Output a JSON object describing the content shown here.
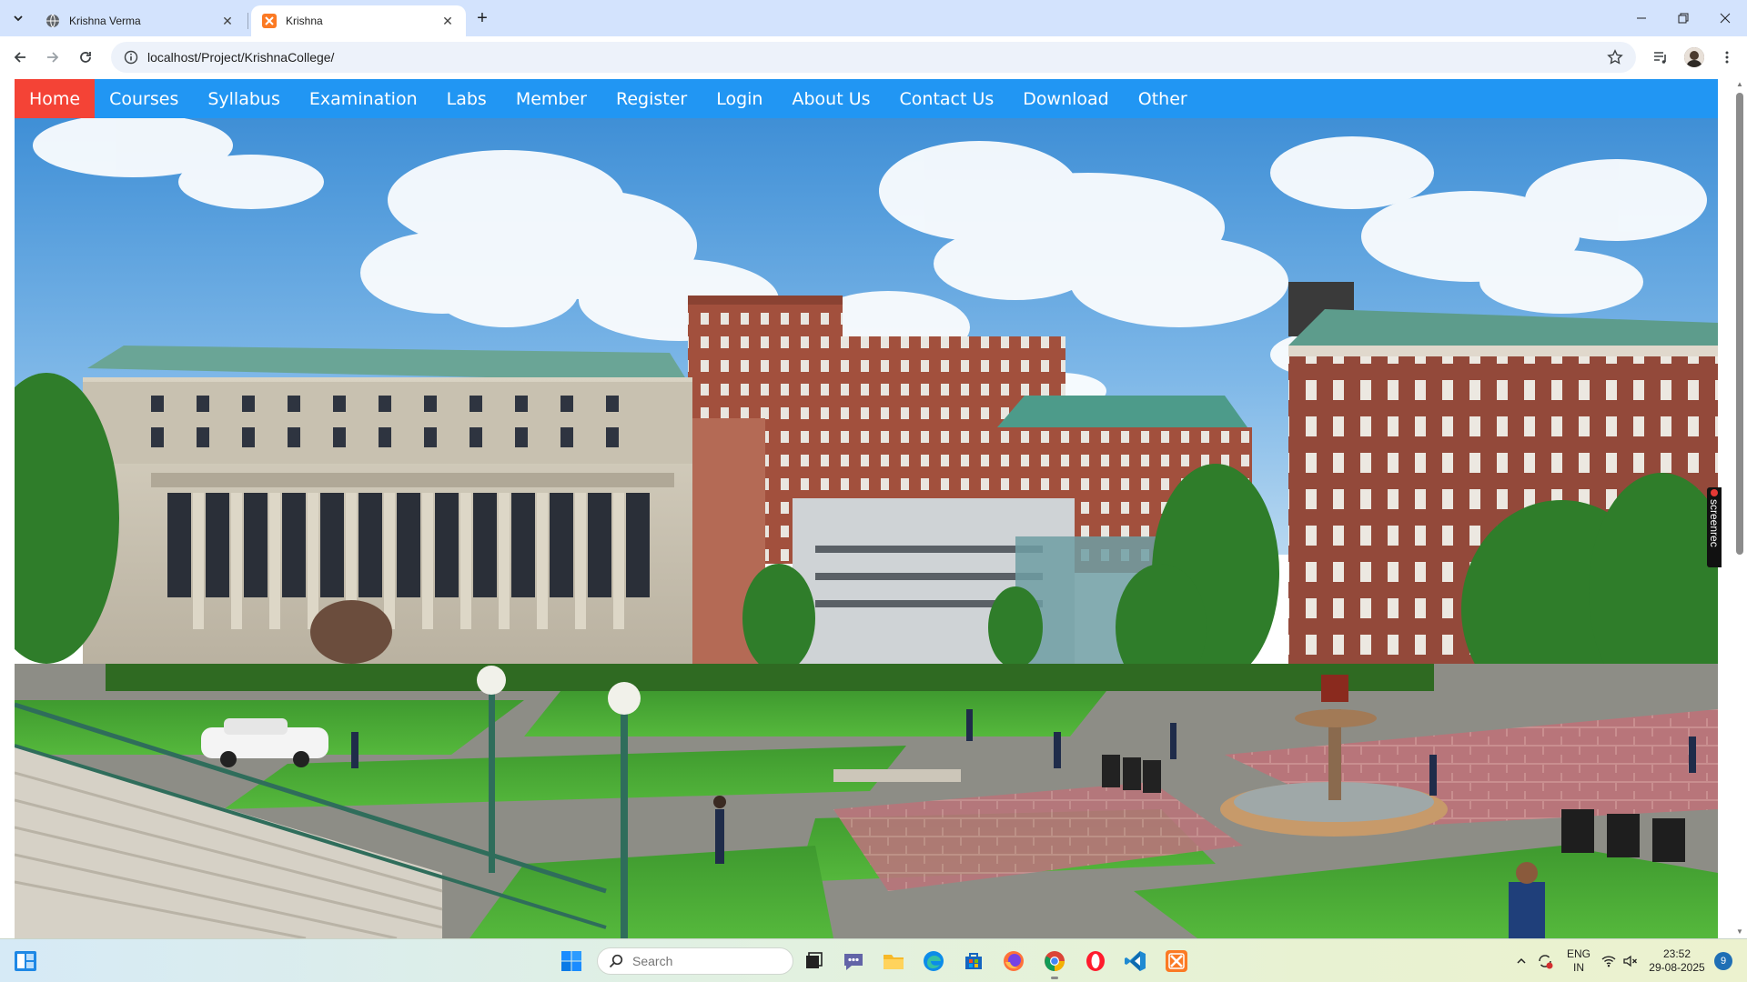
{
  "browser": {
    "tabs": [
      {
        "title": "Krishna Verma",
        "favicon": "globe-icon",
        "active": false
      },
      {
        "title": "Krishna",
        "favicon": "xampp-icon",
        "active": true
      }
    ],
    "new_tab": "+",
    "url": "localhost/Project/KrishnaCollege/",
    "controls": {
      "minimize": "—",
      "restore": "❐",
      "close": "✕"
    }
  },
  "site": {
    "nav": [
      {
        "label": "Home",
        "active": true
      },
      {
        "label": "Courses"
      },
      {
        "label": "Syllabus"
      },
      {
        "label": "Examination"
      },
      {
        "label": "Labs"
      },
      {
        "label": "Member"
      },
      {
        "label": "Register"
      },
      {
        "label": "Login"
      },
      {
        "label": "About Us"
      },
      {
        "label": "Contact Us"
      },
      {
        "label": "Download"
      },
      {
        "label": "Other"
      }
    ],
    "accent": "#2196f3",
    "active_color": "#f44336"
  },
  "overlay": {
    "screenrec": "screenrec"
  },
  "taskbar": {
    "search_placeholder": "Search",
    "language": {
      "line1": "ENG",
      "line2": "IN"
    },
    "time": "23:52",
    "date": "29-08-2025",
    "notifications": "9"
  }
}
